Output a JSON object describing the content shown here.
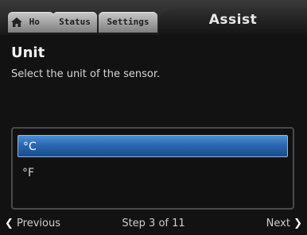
{
  "tabs": {
    "home_label": "Ho",
    "status_label": "Status",
    "settings_label": "Settings",
    "active_label": "Assist"
  },
  "page": {
    "title": "Unit",
    "description": "Select the unit of the sensor."
  },
  "options": [
    {
      "label": "°C",
      "selected": true
    },
    {
      "label": "°F",
      "selected": false
    }
  ],
  "nav": {
    "previous_label": "Previous",
    "step_text": "Step 3 of 11",
    "next_label": "Next"
  },
  "icons": {
    "home": "home-icon",
    "previous": "chevron-left-icon",
    "next": "chevron-right-icon"
  },
  "colors": {
    "selection": "#2a67b0",
    "background": "#121212"
  }
}
